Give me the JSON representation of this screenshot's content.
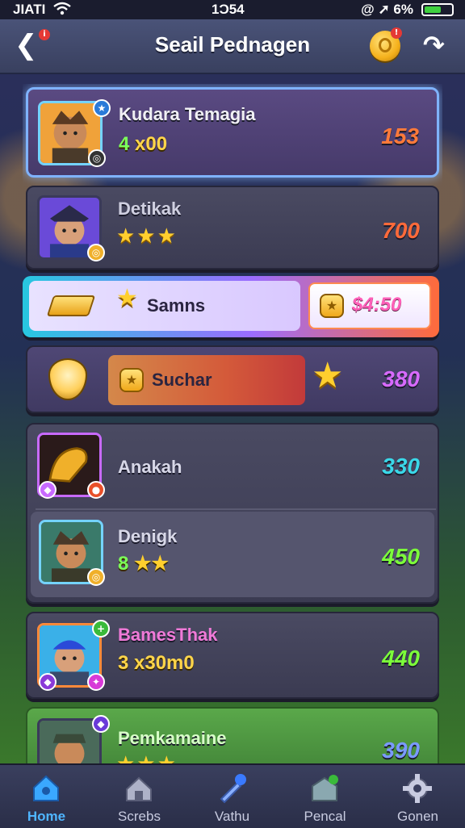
{
  "status_bar": {
    "carrier": "JIATI",
    "time": "1Ɔ54",
    "battery": "6%"
  },
  "header": {
    "title": "Seail Pednagen",
    "back_badge": "i",
    "coin_badge": "!"
  },
  "rows": [
    {
      "name": "Kudara Temagia",
      "level": "4",
      "sub": "x00",
      "score": "153",
      "score_color": "#ff7a3a"
    },
    {
      "name": "Detikak",
      "stars": "★★★",
      "score": "700",
      "score_color": "#ff6a3a"
    },
    {
      "label": "Samns",
      "price": "$4:50"
    },
    {
      "label": "Suchar",
      "score": "380",
      "score_color": "#d86aff"
    },
    {
      "name": "Anakah",
      "score": "330",
      "score_color": "#3ad8e8"
    },
    {
      "name": "Denigk",
      "level": "8",
      "stars": "★★",
      "score": "450",
      "score_color": "#7cff3a"
    },
    {
      "name": "BamesThak",
      "sub": "3 x30m0",
      "score": "440",
      "score_color": "#7cff3a"
    },
    {
      "name": "Pemkamaine",
      "stars": "★★★",
      "score": "390",
      "score_color": "#7a9aff"
    }
  ],
  "tabs": [
    {
      "label": "Home",
      "icon": "home-icon"
    },
    {
      "label": "Screbs",
      "icon": "house-icon"
    },
    {
      "label": "Vathu",
      "icon": "brush-icon"
    },
    {
      "label": "Pencal",
      "icon": "shop-icon"
    },
    {
      "label": "Gonen",
      "icon": "gear-icon"
    }
  ]
}
